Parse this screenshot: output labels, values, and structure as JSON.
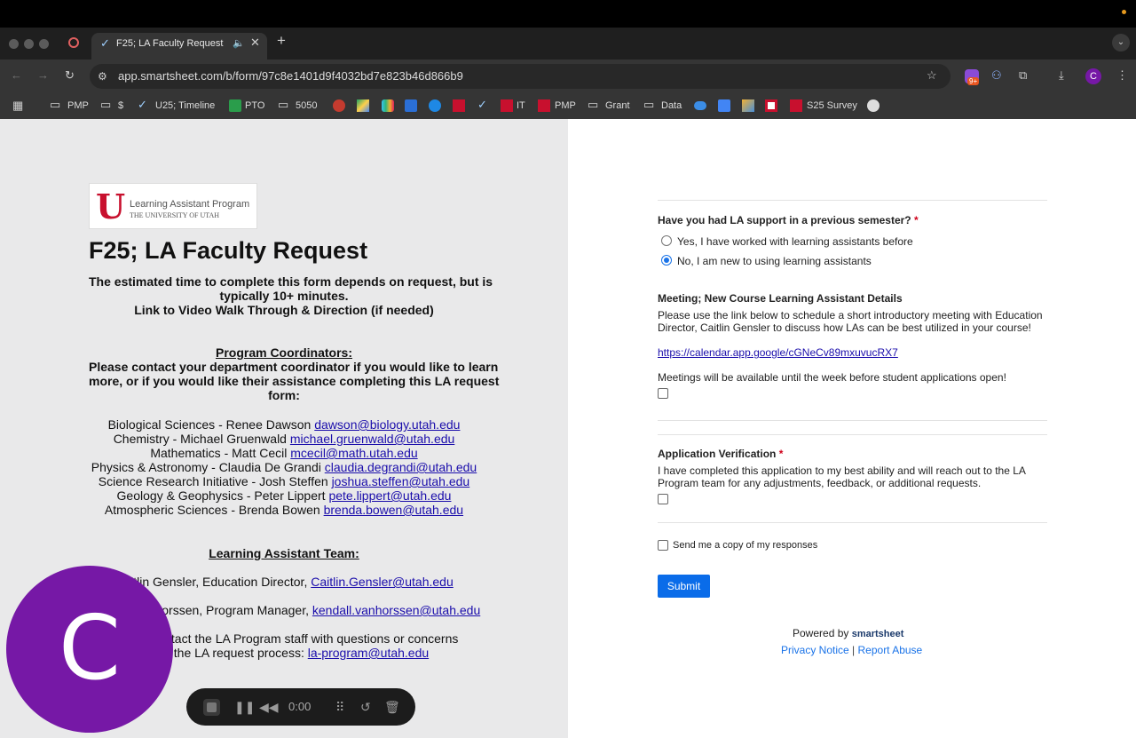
{
  "browser": {
    "tab_title": "F25; LA Faculty Request",
    "url": "app.smartsheet.com/b/form/97c8e1401d9f4032bd7e823b46d866b9",
    "bookmarks": [
      "PMP",
      "$",
      "U25; Timeline",
      "PTO",
      "5050",
      "IT",
      "PMP",
      "Grant",
      "Data",
      "S25 Survey"
    ],
    "badge": "9+",
    "profile_initial": "C"
  },
  "left": {
    "logo_title": "Learning Assistant Program",
    "logo_sub": "THE UNIVERSITY OF UTAH",
    "title": "F25; LA Faculty Request",
    "intro_1": "The estimated time to complete this form depends on request, but is",
    "intro_2": "typically 10+ minutes.",
    "intro_3": "Link to Video Walk Through & Direction (if needed)",
    "coord_heading": "Program Coordinators:",
    "coord_1": "Please contact your department coordinator if you would like to learn",
    "coord_2": "more, or if you would like their assistance completing this LA request",
    "coord_3": "form:",
    "coordinators": [
      {
        "text": "Biological Sciences - Renee Dawson ",
        "email": "dawson@biology.utah.edu"
      },
      {
        "text": "Chemistry - Michael Gruenwald ",
        "email": "michael.gruenwald@utah.edu"
      },
      {
        "text": "Mathematics - Matt Cecil ",
        "email": "mcecil@math.utah.edu"
      },
      {
        "text": "Physics & Astronomy - Claudia De Grandi ",
        "email": "claudia.degrandi@utah.edu"
      },
      {
        "text": "Science Research Initiative - Josh Steffen ",
        "email": "joshua.steffen@utah.edu"
      },
      {
        "text": "Geology & Geophysics - Peter Lippert ",
        "email": "pete.lippert@utah.edu"
      },
      {
        "text": "Atmospheric Sciences - Brenda Bowen ",
        "email": "brenda.bowen@utah.edu"
      }
    ],
    "team_heading": "Learning Assistant Team:",
    "team_1_text": "Caitlin Gensler, Education Director, ",
    "team_1_email": "Caitlin.Gensler@utah.edu",
    "team_2_text": "Kendall Vanhorssen, Program Manager, ",
    "team_2_email": "kendall.vanhorssen@utah.edu",
    "contact_1": "Please contact the LA Program staff with questions or concerns",
    "contact_2": "about the LA request process: ",
    "contact_email": "la-program@utah.edu"
  },
  "form": {
    "q1_label": "Have you had LA support in a previous semester?",
    "q1_opt1": "Yes, I have worked with learning assistants before",
    "q1_opt2": "No, I am new to using learning assistants",
    "q1_selected": "No, I am new to using learning assistants",
    "meeting_heading": "Meeting; New Course Learning Assistant Details",
    "meeting_text_1": "Please use the link below to schedule a short introductory meeting with Education",
    "meeting_text_2": "Director, Caitlin Gensler to discuss how LAs can be best utilized in your course!",
    "meeting_link": "https://calendar.app.google/cGNeCv89mxuvucRX7",
    "meeting_note": "Meetings will be available until the week before student applications open!",
    "verify_heading": "Application Verification",
    "verify_text_1": "I have completed this application to my best ability and will reach out to the LA",
    "verify_text_2": "Program team for any adjustments, feedback, or additional requests.",
    "copy_label": "Send me a copy of my responses",
    "submit": "Submit",
    "powered_by": "Powered by",
    "brand": "smartsheet",
    "privacy": "Privacy Notice",
    "sep": "|",
    "report": "Report Abuse"
  },
  "overlay": {
    "avatar_letter": "C",
    "recorder_time": "0:00"
  }
}
